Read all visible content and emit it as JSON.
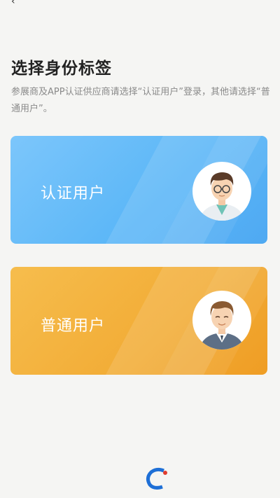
{
  "page": {
    "title": "选择身份标签",
    "description": "参展商及APP认证供应商请选择“认证用户”登录，其他请选择“普通用户”。"
  },
  "cards": {
    "certified": {
      "label": "认证用户",
      "icon": "doctor-avatar-icon"
    },
    "normal": {
      "label": "普通用户",
      "icon": "businessman-avatar-icon"
    }
  },
  "colors": {
    "certified_card": "#5ab6f7",
    "normal_card": "#f2ac36",
    "background": "#f5f5f3"
  }
}
